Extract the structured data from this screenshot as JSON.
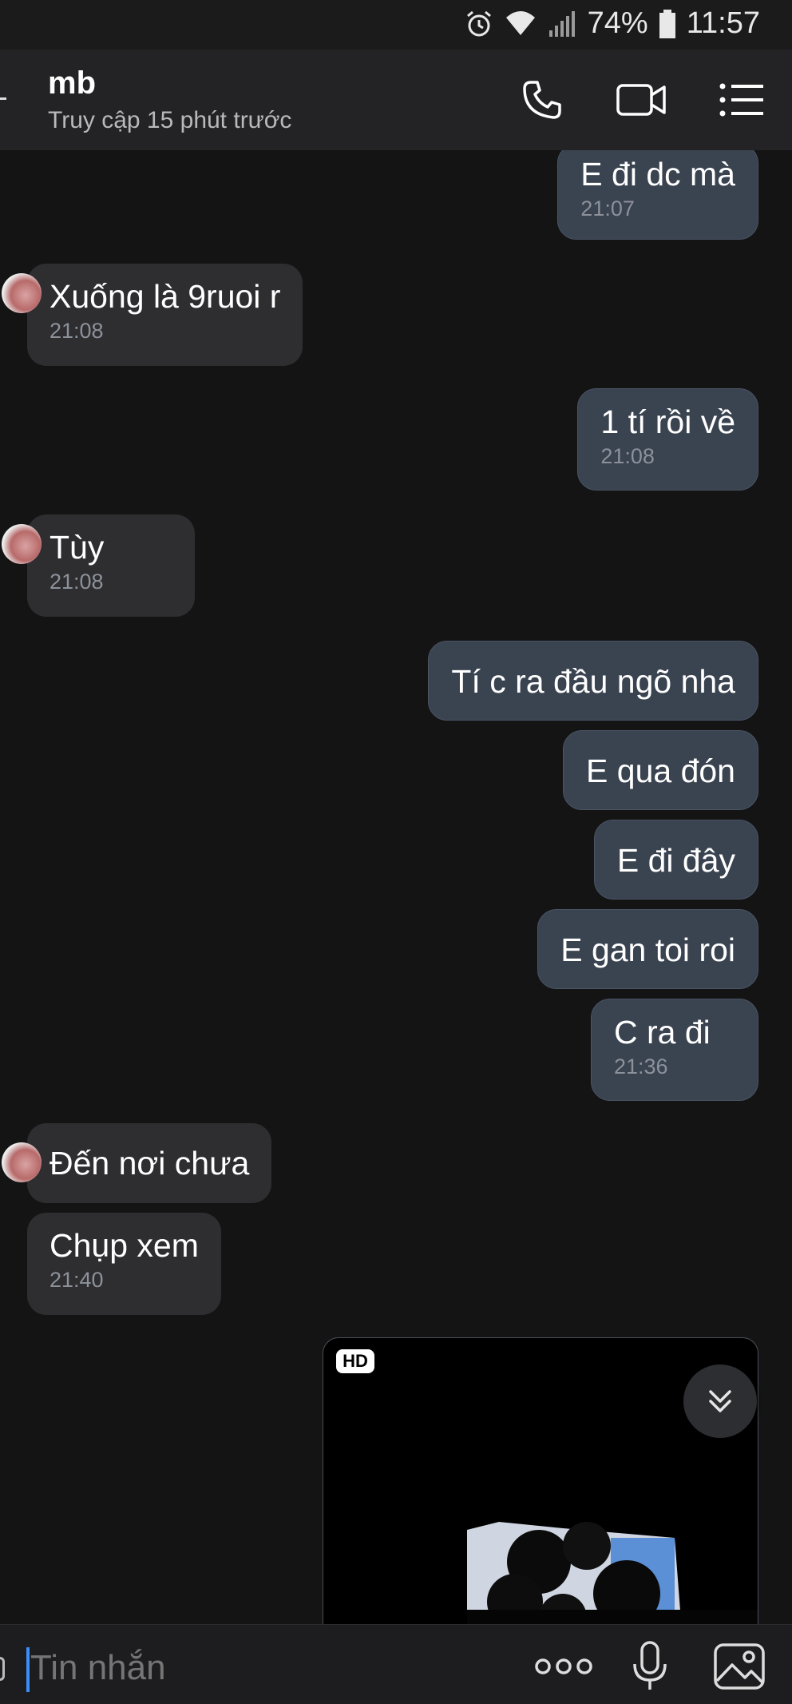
{
  "status_bar": {
    "battery": "74%",
    "time": "11:57",
    "icons": [
      "alarm-icon",
      "wifi-icon",
      "signal-icon",
      "battery-icon"
    ]
  },
  "header": {
    "name": "mb",
    "status": "Truy cập 15 phút trước",
    "buttons": [
      "phone-icon",
      "video-icon",
      "menu-list-icon"
    ]
  },
  "messages": [
    {
      "dir": "out",
      "text": "E đi dc mà",
      "time": "21:07"
    },
    {
      "dir": "in",
      "text": "Xuống là 9ruoi r",
      "time": "21:08"
    },
    {
      "dir": "out",
      "text": "1 tí rồi về",
      "time": "21:08"
    },
    {
      "dir": "in",
      "text": "Tùy",
      "time": "21:08"
    },
    {
      "dir": "out",
      "text": "Tí c ra đầu ngõ nha",
      "time": ""
    },
    {
      "dir": "out",
      "text": "E qua đón",
      "time": ""
    },
    {
      "dir": "out",
      "text": "E đi đây",
      "time": ""
    },
    {
      "dir": "out",
      "text": "E gan toi roi",
      "time": ""
    },
    {
      "dir": "out",
      "text": "C ra đi",
      "time": "21:36"
    },
    {
      "dir": "in",
      "text": "Đến nơi chưa",
      "time": ""
    },
    {
      "dir": "in",
      "text": "Chụp xem",
      "time": "21:40"
    }
  ],
  "media": {
    "badge": "HD"
  },
  "input": {
    "placeholder": "Tin nhắn"
  },
  "colors": {
    "accent": "#3a8ef6",
    "outgoing_bubble": "#3a4350",
    "incoming_bubble": "#2e2e30"
  }
}
